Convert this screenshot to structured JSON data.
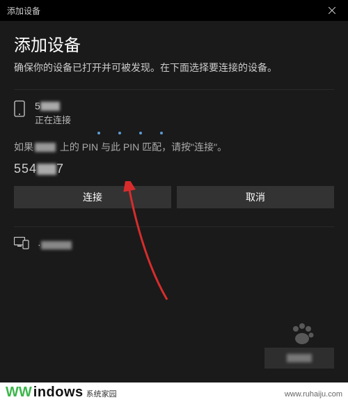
{
  "titlebar": {
    "title": "添加设备"
  },
  "heading": "添加设备",
  "subheading": "确保你的设备已打开并可被发现。在下面选择要连接的设备。",
  "device": {
    "name_visible_prefix": "5",
    "status": "正在连接",
    "pin_text_before": "如果",
    "pin_text_after": "上的 PIN 与此 PIN 匹配，请按\"连接\"。",
    "pin_value_prefix": "554",
    "pin_value_suffix": "7"
  },
  "buttons": {
    "connect": "连接",
    "cancel": "取消"
  },
  "other_device": {
    "prefix": "·"
  },
  "bottom": {
    "label": ""
  },
  "watermark": {
    "main": "indows",
    "sub": "系统家园",
    "url": "www.ruhaiju.com"
  },
  "colors": {
    "accent": "#5b9bd5",
    "arrow": "#d82c2c",
    "green": "#3cb64b"
  }
}
